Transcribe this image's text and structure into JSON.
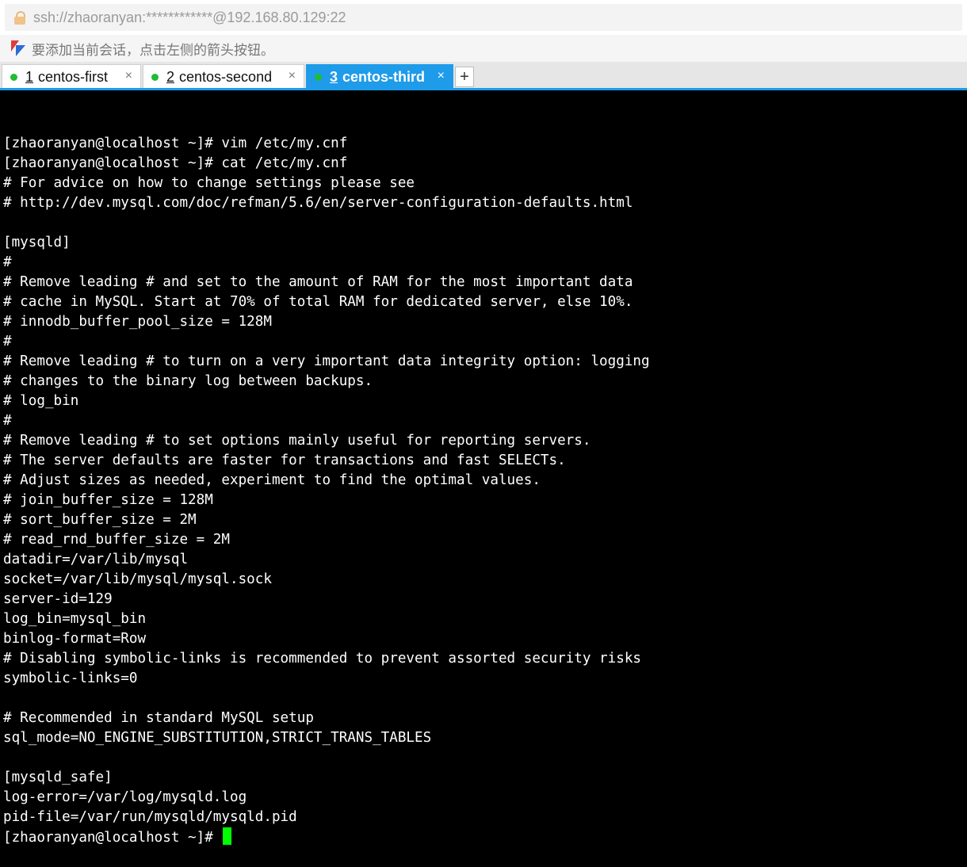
{
  "address": "ssh://zhaoranyan:************@192.168.80.129:22",
  "hint": "要添加当前会话，点击左侧的箭头按钮。",
  "tabs": [
    {
      "number": "1",
      "name": "centos-first",
      "dot": "#22bb33",
      "active": false
    },
    {
      "number": "2",
      "name": "centos-second",
      "dot": "#22bb33",
      "active": false
    },
    {
      "number": "3",
      "name": "centos-third",
      "dot": "#22bb33",
      "active": true
    }
  ],
  "close_glyph": "×",
  "plus_glyph": "+",
  "terminal": {
    "lines": [
      "[zhaoranyan@localhost ~]# vim /etc/my.cnf",
      "[zhaoranyan@localhost ~]# cat /etc/my.cnf",
      "# For advice on how to change settings please see",
      "# http://dev.mysql.com/doc/refman/5.6/en/server-configuration-defaults.html",
      "",
      "[mysqld]",
      "#",
      "# Remove leading # and set to the amount of RAM for the most important data",
      "# cache in MySQL. Start at 70% of total RAM for dedicated server, else 10%.",
      "# innodb_buffer_pool_size = 128M",
      "#",
      "# Remove leading # to turn on a very important data integrity option: logging",
      "# changes to the binary log between backups.",
      "# log_bin",
      "#",
      "# Remove leading # to set options mainly useful for reporting servers.",
      "# The server defaults are faster for transactions and fast SELECTs.",
      "# Adjust sizes as needed, experiment to find the optimal values.",
      "# join_buffer_size = 128M",
      "# sort_buffer_size = 2M",
      "# read_rnd_buffer_size = 2M",
      "datadir=/var/lib/mysql",
      "socket=/var/lib/mysql/mysql.sock",
      "server-id=129",
      "log_bin=mysql_bin",
      "binlog-format=Row",
      "# Disabling symbolic-links is recommended to prevent assorted security risks",
      "symbolic-links=0",
      "",
      "# Recommended in standard MySQL setup",
      "sql_mode=NO_ENGINE_SUBSTITUTION,STRICT_TRANS_TABLES",
      "",
      "[mysqld_safe]",
      "log-error=/var/log/mysqld.log",
      "pid-file=/var/run/mysqld/mysqld.pid"
    ],
    "prompt": "[zhaoranyan@localhost ~]# ",
    "cursor_color": "#00ff00"
  }
}
